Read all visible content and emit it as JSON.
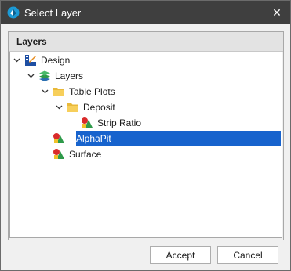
{
  "window": {
    "title": "Select Layer",
    "close_glyph": "✕"
  },
  "group": {
    "title": "Layers"
  },
  "tree": {
    "items": [
      {
        "label": "Design",
        "icon": "design-icon",
        "expanded": true
      },
      {
        "label": "Layers",
        "icon": "layers-stack-icon",
        "expanded": true
      },
      {
        "label": "Table Plots",
        "icon": "folder-icon",
        "expanded": true
      },
      {
        "label": "Deposit",
        "icon": "folder-icon",
        "expanded": true
      },
      {
        "label": "Strip Ratio",
        "icon": "layer-shapes-icon"
      },
      {
        "label": "AlphaPit",
        "icon": "layer-shapes-icon",
        "selected": true
      },
      {
        "label": "Surface",
        "icon": "layer-shapes-icon"
      }
    ]
  },
  "buttons": {
    "accept": "Accept",
    "cancel": "Cancel"
  },
  "colors": {
    "titlebar": "#3f3f3f",
    "selection": "#1763cd",
    "folder": "#f7cf5b"
  }
}
